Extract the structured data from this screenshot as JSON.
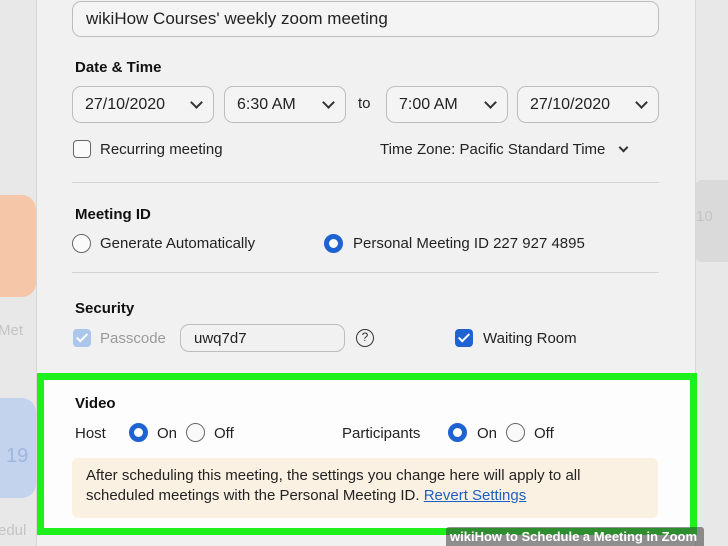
{
  "meeting": {
    "topic_value": "wikiHow Courses' weekly zoom meeting"
  },
  "date_time": {
    "heading": "Date & Time",
    "start_date": "27/10/2020",
    "start_time": "6:30 AM",
    "to_label": "to",
    "end_time": "7:00 AM",
    "end_date": "27/10/2020",
    "recurring_label": "Recurring meeting",
    "recurring_checked": false,
    "time_zone": "Time Zone:  Pacific Standard Time"
  },
  "meeting_id": {
    "heading": "Meeting ID",
    "option_auto": "Generate Automatically",
    "option_personal": "Personal Meeting ID 227 927 4895",
    "selected": "personal"
  },
  "security": {
    "heading": "Security",
    "passcode_label": "Passcode",
    "passcode_value": "uwq7d7",
    "help_glyph": "?",
    "waiting_room_label": "Waiting Room",
    "waiting_room_checked": true
  },
  "video": {
    "heading": "Video",
    "host_label": "Host",
    "host_on": "On",
    "host_off": "Off",
    "participants_label": "Participants",
    "participants_on": "On",
    "participants_off": "Off",
    "host_selected": "on",
    "participants_selected": "on"
  },
  "notice": {
    "text": "After scheduling this meeting, the settings you change here will apply to all scheduled meetings with the Personal Meeting ID. ",
    "link": "Revert Settings"
  },
  "background": {
    "left_text_1": "Met",
    "left_text_2": "edul",
    "left_icon_text": "19",
    "right_text": "10"
  },
  "watermark": {
    "brand": "wiki",
    "title": "How to Schedule a Meeting in Zoom"
  },
  "colors": {
    "accent": "#1f63d2",
    "highlight": "#1df01d",
    "notice_bg": "#fbf1e3",
    "link": "#1f5fbf"
  }
}
